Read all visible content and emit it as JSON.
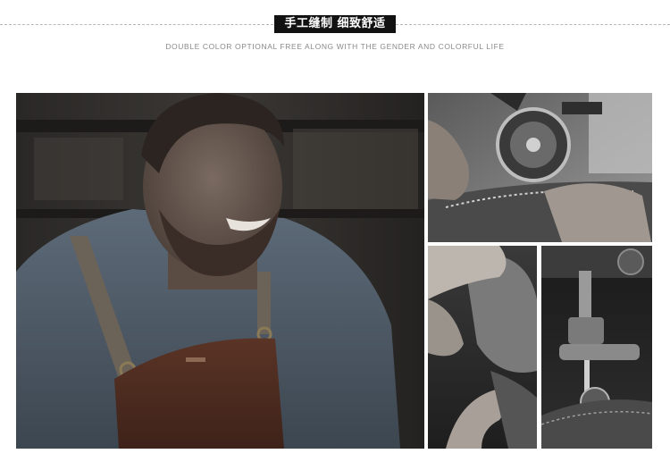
{
  "header": {
    "title": "手工缝制  细致舒适",
    "subtitle": "DOUBLE COLOR OPTIONAL FREE ALONG WITH THE GENDER AND COLORFUL LIFE"
  },
  "photos": {
    "main": "craftsman-leather-apron-photo",
    "top_right": "sewing-machine-wheel-photo",
    "bottom_left": "hands-folding-leather-photo",
    "bottom_right": "sewing-machine-needle-photo"
  }
}
